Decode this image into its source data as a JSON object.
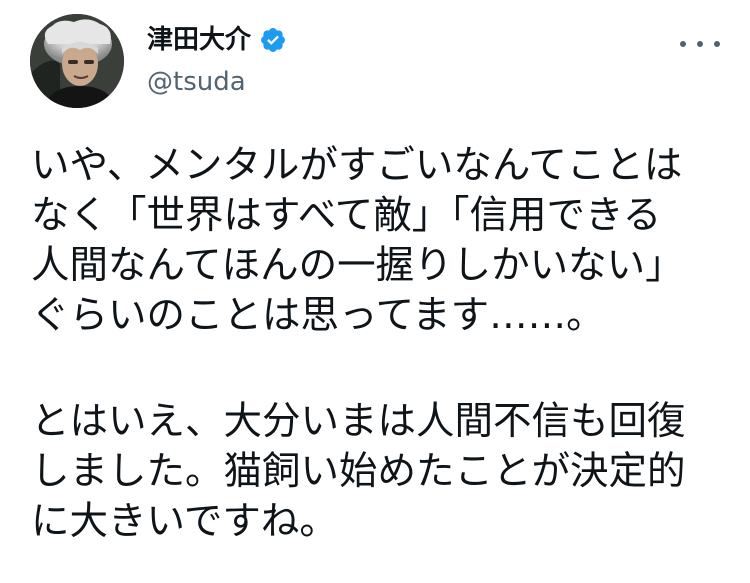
{
  "author": {
    "display_name": "津田大介",
    "handle": "@tsuda",
    "verified_icon": "verified-badge-icon",
    "avatar": "avatar-photo"
  },
  "more_icon": "more-options-icon",
  "colors": {
    "text": "#0f1419",
    "secondary": "#536471",
    "verified": "#1d9bf0"
  },
  "tweet": {
    "paragraph1": [
      "いや、メンタルがすごいなんてことは",
      "なく「世界はすべて敵」「信用できる",
      "人間なんてほんの一握りしかいない」",
      "ぐらいのことは思ってます……。"
    ],
    "paragraph2": [
      "とはいえ、大分いまは人間不信も回復",
      "しました。猫飼い始めたことが決定的",
      "に大きいですね。"
    ]
  }
}
